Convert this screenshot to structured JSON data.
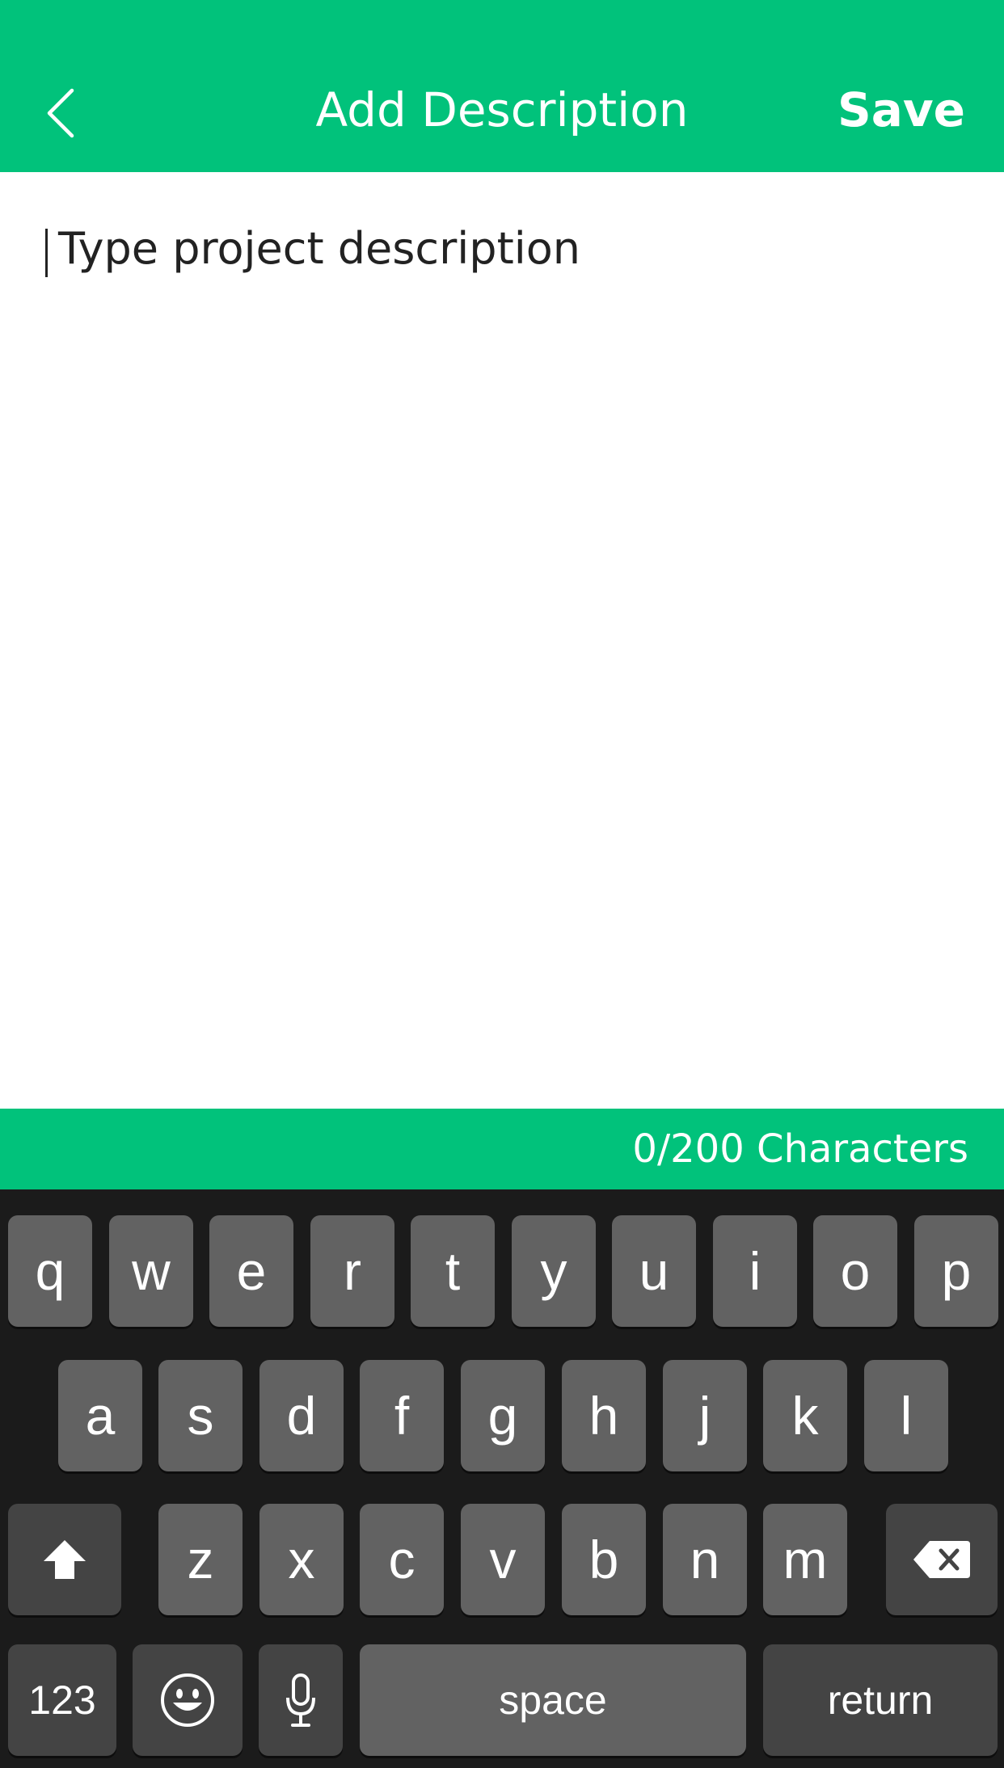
{
  "header": {
    "back_icon": "chevron-left-icon",
    "title": "Add Description",
    "save_label": "Save",
    "background_color": "#01c27b"
  },
  "editor": {
    "value": "",
    "placeholder": "Type project description"
  },
  "counter": {
    "text": "0/200 Characters"
  },
  "keyboard": {
    "row1": [
      "q",
      "w",
      "e",
      "r",
      "t",
      "y",
      "u",
      "i",
      "o",
      "p"
    ],
    "row2": [
      "a",
      "s",
      "d",
      "f",
      "g",
      "h",
      "j",
      "k",
      "l"
    ],
    "row3": [
      "z",
      "x",
      "c",
      "v",
      "b",
      "n",
      "m"
    ],
    "shift_icon": "shift-arrow-icon",
    "delete_icon": "backspace-icon",
    "numbers_label": "123",
    "emoji_icon": "emoji-icon",
    "mic_icon": "microphone-icon",
    "space_label": "space",
    "return_label": "return"
  }
}
